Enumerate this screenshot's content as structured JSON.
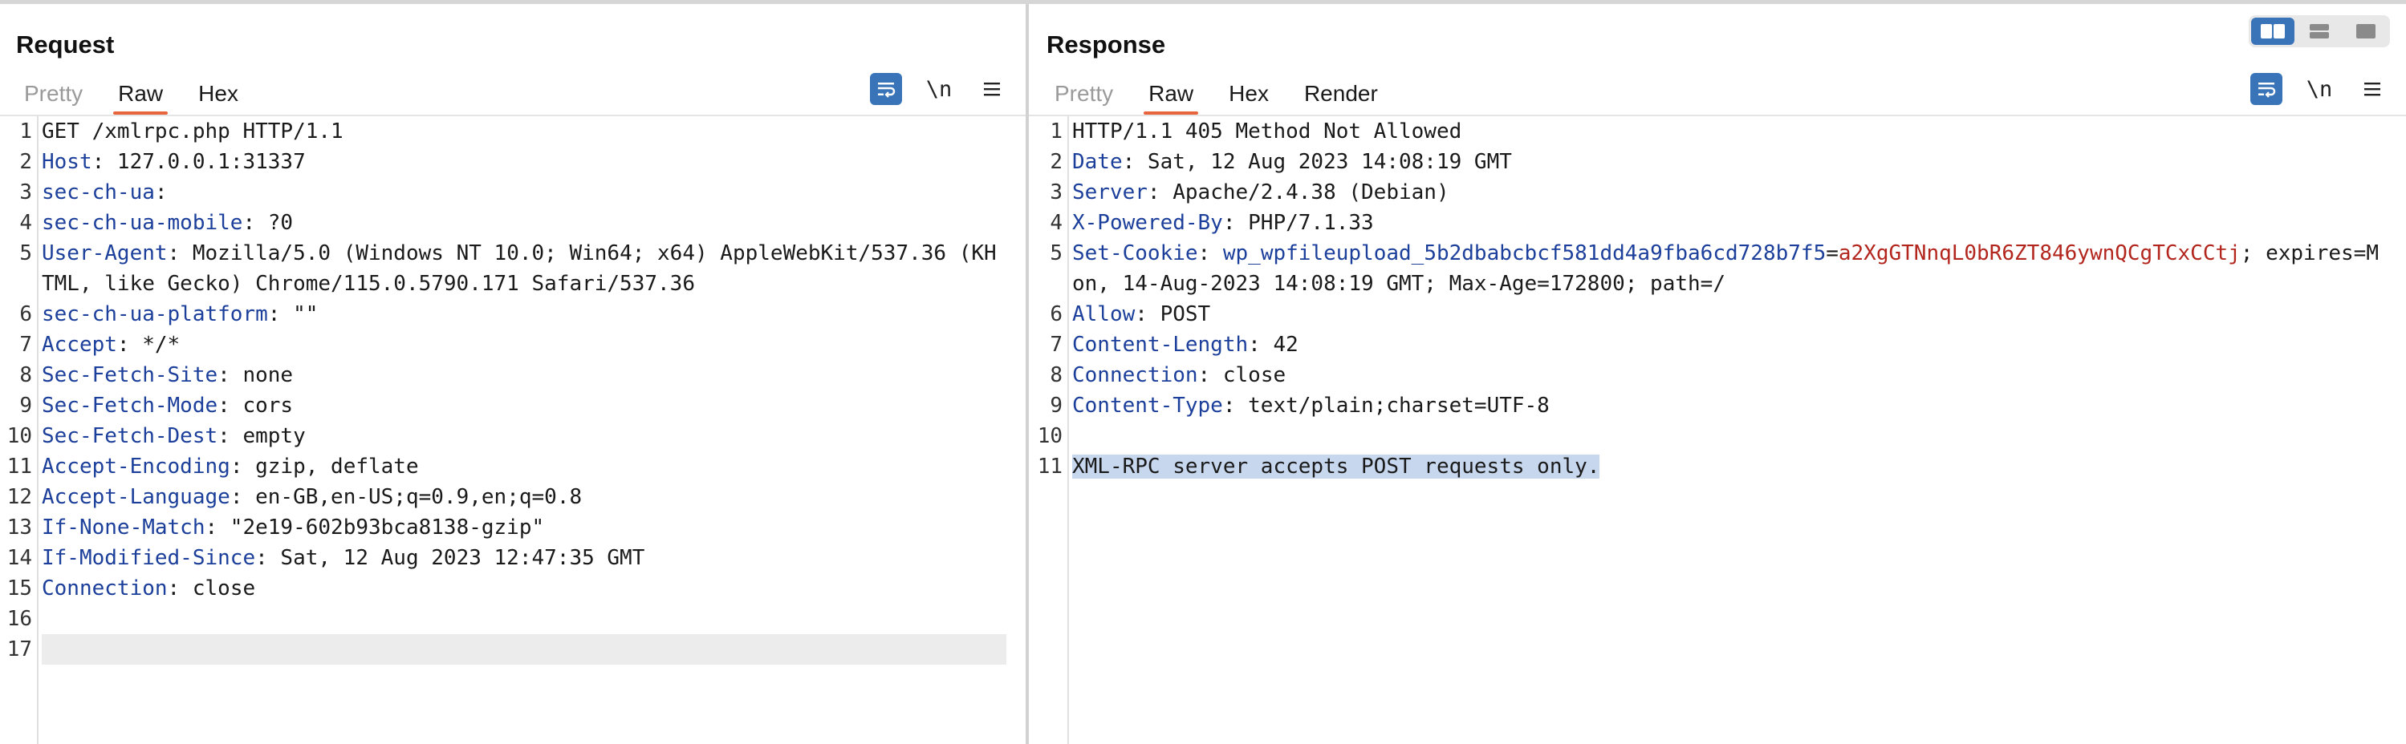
{
  "request": {
    "title": "Request",
    "tabs": [
      {
        "label": "Pretty",
        "state": "disabled"
      },
      {
        "label": "Raw",
        "state": "active"
      },
      {
        "label": "Hex",
        "state": "normal"
      }
    ],
    "tools": {
      "wrap_icon": "word-wrap-icon",
      "newline_label": "\\n",
      "menu_icon": "hamburger-menu-icon"
    },
    "lines": [
      {
        "n": "1",
        "name": "",
        "value": "GET /xmlrpc.php HTTP/1.1"
      },
      {
        "n": "2",
        "name": "Host",
        "value": " 127.0.0.1:31337"
      },
      {
        "n": "3",
        "name": "sec-ch-ua",
        "value": ""
      },
      {
        "n": "4",
        "name": "sec-ch-ua-mobile",
        "value": " ?0"
      },
      {
        "n": "5",
        "name": "User-Agent",
        "value": " Mozilla/5.0 (Windows NT 10.0; Win64; x64) AppleWebKit/537.36 (KHTML, like Gecko) Chrome/115.0.5790.171 Safari/537.36"
      },
      {
        "n": "6",
        "name": "sec-ch-ua-platform",
        "value": " \"\""
      },
      {
        "n": "7",
        "name": "Accept",
        "value": " */*"
      },
      {
        "n": "8",
        "name": "Sec-Fetch-Site",
        "value": " none"
      },
      {
        "n": "9",
        "name": "Sec-Fetch-Mode",
        "value": " cors"
      },
      {
        "n": "10",
        "name": "Sec-Fetch-Dest",
        "value": " empty"
      },
      {
        "n": "11",
        "name": "Accept-Encoding",
        "value": " gzip, deflate"
      },
      {
        "n": "12",
        "name": "Accept-Language",
        "value": " en-GB,en-US;q=0.9,en;q=0.8"
      },
      {
        "n": "13",
        "name": "If-None-Match",
        "value": " \"2e19-602b93bca8138-gzip\""
      },
      {
        "n": "14",
        "name": "If-Modified-Since",
        "value": " Sat, 12 Aug 2023 12:47:35 GMT"
      },
      {
        "n": "15",
        "name": "Connection",
        "value": " close"
      },
      {
        "n": "16",
        "name": "",
        "value": ""
      },
      {
        "n": "17",
        "name": "",
        "value": ""
      }
    ]
  },
  "response": {
    "title": "Response",
    "tabs": [
      {
        "label": "Pretty",
        "state": "disabled"
      },
      {
        "label": "Raw",
        "state": "active"
      },
      {
        "label": "Hex",
        "state": "normal"
      },
      {
        "label": "Render",
        "state": "normal"
      }
    ],
    "tools": {
      "wrap_icon": "word-wrap-icon",
      "newline_label": "\\n",
      "menu_icon": "hamburger-menu-icon"
    },
    "lines": [
      {
        "n": "1",
        "name": "",
        "value": "HTTP/1.1 405 Method Not Allowed"
      },
      {
        "n": "2",
        "name": "Date",
        "value": " Sat, 12 Aug 2023 14:08:19 GMT"
      },
      {
        "n": "3",
        "name": "Server",
        "value": " Apache/2.4.38 (Debian)"
      },
      {
        "n": "4",
        "name": "X-Powered-By",
        "value": " PHP/7.1.33"
      },
      {
        "n": "5",
        "name": "Set-Cookie",
        "cookie_name": "wp_wpfileupload_5b2dbabcbcf581dd4a9fba6cd728b7f5",
        "cookie_value": "a2XgGTNnqL0bR6ZT846ywnQCgTCxCCtj",
        "value": "; expires=Mon, 14-Aug-2023 14:08:19 GMT; Max-Age=172800; path=/"
      },
      {
        "n": "6",
        "name": "Allow",
        "value": " POST"
      },
      {
        "n": "7",
        "name": "Content-Length",
        "value": " 42"
      },
      {
        "n": "8",
        "name": "Connection",
        "value": " close"
      },
      {
        "n": "9",
        "name": "Content-Type",
        "value": " text/plain;charset=UTF-8"
      },
      {
        "n": "10",
        "name": "",
        "value": ""
      },
      {
        "n": "11",
        "name": "",
        "value": "XML-RPC server accepts POST requests only."
      }
    ]
  },
  "layout_switch": {
    "buttons": [
      {
        "icon": "side-by-side-layout-icon",
        "active": true
      },
      {
        "icon": "top-bottom-layout-icon",
        "active": false
      },
      {
        "icon": "single-pane-layout-icon",
        "active": false
      }
    ]
  },
  "colors": {
    "header_name": "#1b3f9a",
    "cookie_value": "#b3261e",
    "accent_tab": "#e8643c",
    "tool_active": "#3a74b8",
    "selection": "#c7d7ee"
  }
}
